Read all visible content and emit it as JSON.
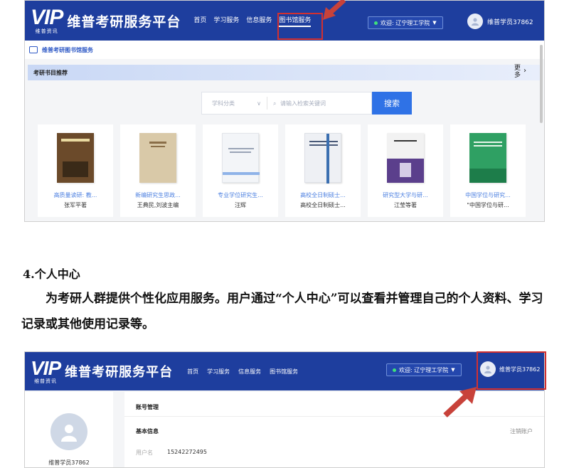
{
  "header": {
    "logo_text": "VIP",
    "logo_sub": "维普资讯",
    "site_name": "维普考研服务平台",
    "nav": [
      "首页",
      "学习服务",
      "信息服务",
      "图书馆服务"
    ],
    "welcome": "欢迎: 辽宁理工学院",
    "username": "维普学员37862"
  },
  "library": {
    "breadcrumb": "维普考研图书馆服务",
    "section": "考研书目推荐",
    "more": "更多",
    "search": {
      "category": "学科分类",
      "placeholder": "请输入检索关键词",
      "button": "搜索"
    },
    "books": [
      {
        "title": "高质量读研: 教...",
        "author": "张军平著",
        "cover_color": "#6b4a2a"
      },
      {
        "title": "新编研究生思政...",
        "author": "王典民,刘波主编",
        "cover_color": "#d9c9a8"
      },
      {
        "title": "专业学位研究生...",
        "author": "汪辉",
        "cover_color": "#f3f5f8"
      },
      {
        "title": "高校全日制硕士...",
        "author": "高校全日制硕士...",
        "cover_color": "#eef0f4"
      },
      {
        "title": "研究型大学与研...",
        "author": "江莹等著",
        "cover_color": "#5b3f8c"
      },
      {
        "title": "中国学位与研究...",
        "author": "\"中国学位与研...",
        "cover_color": "#2fa063"
      }
    ]
  },
  "doc": {
    "section_title": "4.个人中心",
    "paragraph": "为考研人群提供个性化应用服务。用户通过“个人中心”可以查看并管理自己的个人资料、学习记录或其他使用记录等。"
  },
  "profile": {
    "username": "维普学员37862",
    "account_title": "账号管理",
    "basic_info": "基本信息",
    "logout": "注销账户",
    "uname_label": "用户名",
    "uname_value": "15242272495"
  },
  "colors": {
    "header_bg": "#1e3e9e",
    "highlight_red": "#d23030",
    "search_button": "#2f72e6"
  }
}
